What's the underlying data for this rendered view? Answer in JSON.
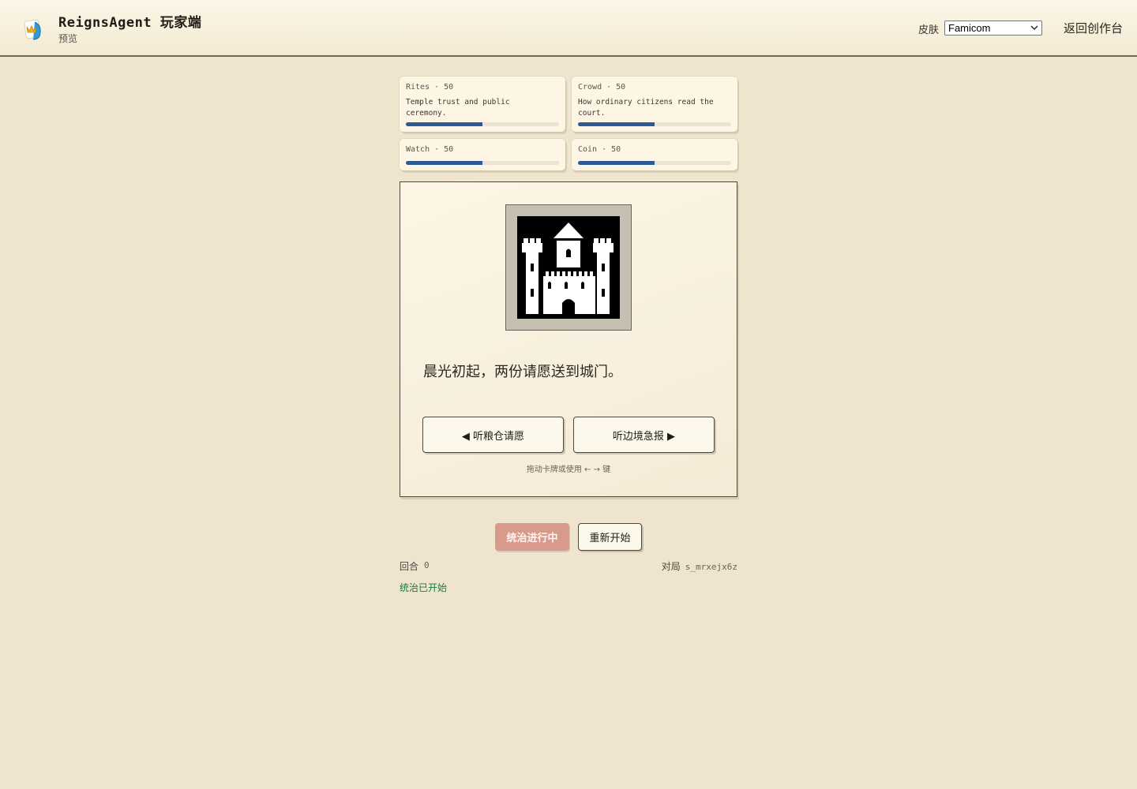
{
  "header": {
    "title": "ReignsAgent 玩家端",
    "subtitle": "预览",
    "skin_label": "皮肤",
    "skin_selected": "Famicom",
    "back_link": "返回创作台",
    "logo_icon": "crown-card-icon"
  },
  "stats": [
    {
      "name": "Rites",
      "value": 50,
      "head": "Rites · 50",
      "desc": "Temple trust and public ceremony."
    },
    {
      "name": "Crowd",
      "value": 50,
      "head": "Crowd · 50",
      "desc": "How ordinary citizens read the court."
    },
    {
      "name": "Watch",
      "value": 50,
      "head": "Watch · 50",
      "desc": ""
    },
    {
      "name": "Coin",
      "value": 50,
      "head": "Coin · 50",
      "desc": ""
    }
  ],
  "card": {
    "art_icon": "castle-icon",
    "prompt": "晨光初起，两份请愿送到城门。",
    "left_choice": "◀ 听粮仓请愿",
    "right_choice": "听边境急报 ▶",
    "hint": "拖动卡牌或使用 ← → 键"
  },
  "controls": {
    "status_button": "统治进行中",
    "restart_button": "重新开始"
  },
  "footer": {
    "round_label": "回合",
    "round_value": "0",
    "session_label": "对局",
    "session_id": "s_mrxejx6z",
    "status_message": "统治已开始"
  },
  "colors": {
    "background": "#efe4cd",
    "bar_fill": "#2e5a93",
    "status_button": "#d89a8c",
    "status_message": "#1d7a3f"
  }
}
